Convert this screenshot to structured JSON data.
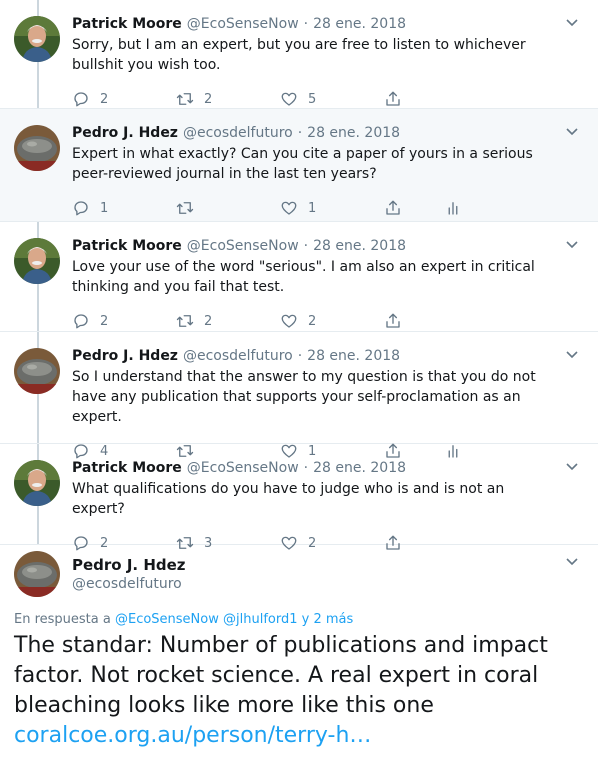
{
  "colors": {
    "link": "#1da1f2",
    "muted": "#657786",
    "text": "#14171a",
    "highlight": "#f5f8fa"
  },
  "tweets": [
    {
      "name": "Patrick Moore",
      "handle": "@EcoSenseNow",
      "dot": "·",
      "date": "28 ene. 2018",
      "text": "Sorry, but I am an expert, but you are free to listen to whichever bullshit you wish too.",
      "replies": "2",
      "retweets": "2",
      "likes": "5",
      "avatar": "patrick",
      "analytics": false,
      "highlight": false
    },
    {
      "name": "Pedro J. Hdez",
      "handle": "@ecosdelfuturo",
      "dot": "·",
      "date": "28 ene. 2018",
      "text": "Expert in what exactly? Can you cite a paper of yours in a serious peer-reviewed journal in the last ten years?",
      "replies": "1",
      "retweets": "",
      "likes": "1",
      "avatar": "pedro",
      "analytics": true,
      "highlight": true
    },
    {
      "name": "Patrick Moore",
      "handle": "@EcoSenseNow",
      "dot": "·",
      "date": "28 ene. 2018",
      "text": "Love your use of the word \"serious\". I am also an expert in critical thinking and you fail that test.",
      "replies": "2",
      "retweets": "2",
      "likes": "2",
      "avatar": "patrick",
      "analytics": false,
      "highlight": false
    },
    {
      "name": "Pedro J. Hdez",
      "handle": "@ecosdelfuturo",
      "dot": "·",
      "date": "28 ene. 2018",
      "text": "So I understand that the answer to my question is that you do not have any publication that supports your self-proclamation as an expert.",
      "replies": "4",
      "retweets": "",
      "likes": "1",
      "avatar": "pedro",
      "analytics": true,
      "highlight": false
    },
    {
      "name": "Patrick Moore",
      "handle": "@EcoSenseNow",
      "dot": "·",
      "date": "28 ene. 2018",
      "text": "What qualifications do you have to judge who is and is not an expert?",
      "replies": "2",
      "retweets": "3",
      "likes": "2",
      "avatar": "patrick",
      "analytics": false,
      "highlight": false
    }
  ],
  "focus": {
    "name": "Pedro J. Hdez",
    "handle": "@ecosdelfuturo",
    "reply_prefix": "En respuesta a",
    "reply_users": "@EcoSenseNow @jlhulford1",
    "reply_suffix": "y 2 más",
    "text": "The standar: Number of publications and impact factor. Not rocket science. A real expert in coral bleaching looks like more like this one",
    "link": "coralcoe.org.au/person/terry-h…"
  }
}
